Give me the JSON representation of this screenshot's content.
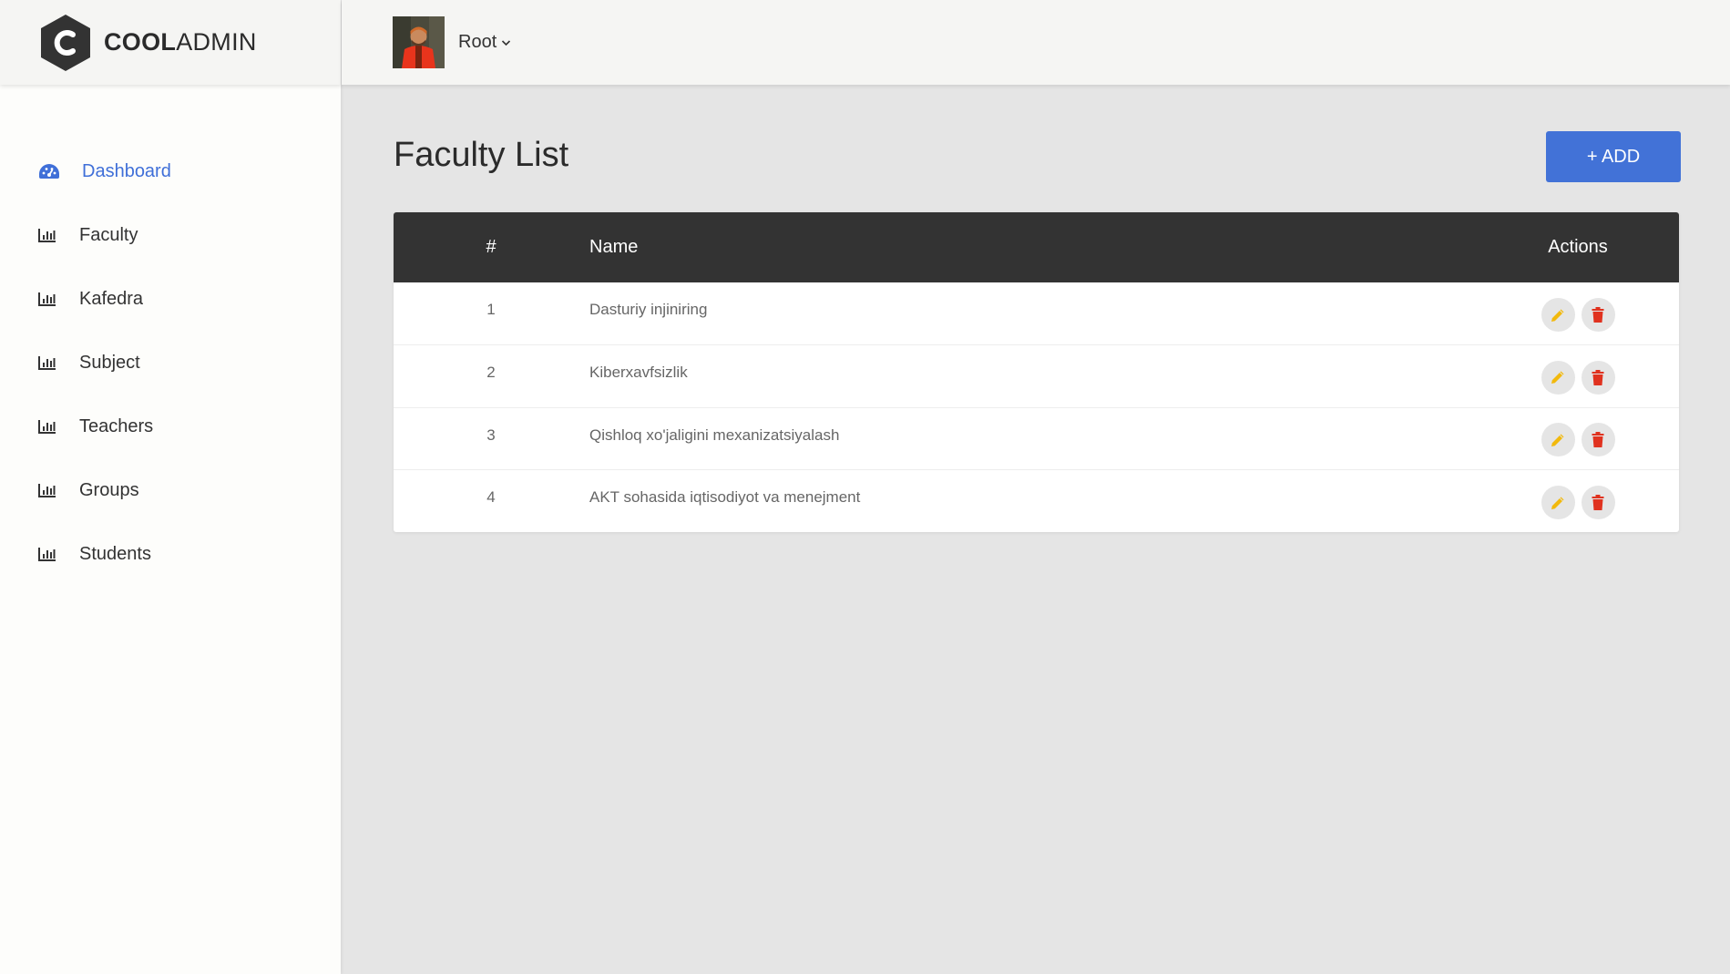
{
  "brand": {
    "bold": "COOL",
    "light": "ADMIN"
  },
  "sidebar": {
    "items": [
      {
        "label": "Dashboard",
        "icon": "dashboard-icon",
        "active": true
      },
      {
        "label": "Faculty",
        "icon": "bar-chart-icon"
      },
      {
        "label": "Kafedra",
        "icon": "bar-chart-icon"
      },
      {
        "label": "Subject",
        "icon": "bar-chart-icon"
      },
      {
        "label": "Teachers",
        "icon": "bar-chart-icon"
      },
      {
        "label": "Groups",
        "icon": "bar-chart-icon"
      },
      {
        "label": "Students",
        "icon": "bar-chart-icon"
      }
    ]
  },
  "header": {
    "user_name": "Root"
  },
  "main": {
    "title": "Faculty List",
    "add_label": "+ ADD",
    "columns": {
      "num": "#",
      "name": "Name",
      "actions": "Actions"
    },
    "rows": [
      {
        "num": "1",
        "name": "Dasturiy injiniring"
      },
      {
        "num": "2",
        "name": "Kiberxavfsizlik"
      },
      {
        "num": "3",
        "name": "Qishloq xo'jaligini mexanizatsiyalash"
      },
      {
        "num": "4",
        "name": "AKT sohasida iqtisodiyot va menejment"
      }
    ]
  },
  "colors": {
    "accent": "#4272d7",
    "active_nav": "#3f6fd8",
    "table_header": "#333333",
    "edit_icon": "#f2b90c",
    "delete_icon": "#e0321f"
  }
}
